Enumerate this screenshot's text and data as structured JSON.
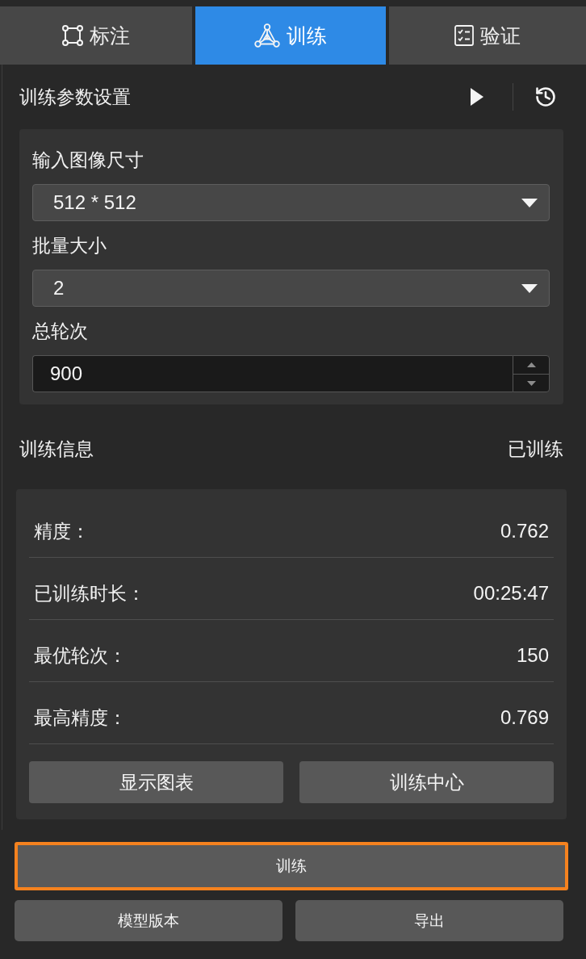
{
  "tabs": [
    {
      "label": "标注",
      "selected": false
    },
    {
      "label": "训练",
      "selected": true
    },
    {
      "label": "验证",
      "selected": false
    }
  ],
  "params": {
    "title": "训练参数设置",
    "fields": [
      {
        "kind": "select",
        "label": "输入图像尺寸",
        "value": "512 * 512"
      },
      {
        "kind": "select",
        "label": "批量大小",
        "value": "2"
      },
      {
        "kind": "number",
        "label": "总轮次",
        "value": "900"
      }
    ]
  },
  "info": {
    "title": "训练信息",
    "status": "已训练",
    "rows": [
      {
        "label": "精度：",
        "value": "0.762"
      },
      {
        "label": "已训练时长：",
        "value": "00:25:47"
      },
      {
        "label": "最优轮次：",
        "value": "150"
      },
      {
        "label": "最高精度：",
        "value": "0.769"
      }
    ],
    "buttons": [
      {
        "label": "显示图表"
      },
      {
        "label": "训练中心"
      }
    ]
  },
  "train_button": {
    "label": "训练",
    "focused": true
  },
  "footer_buttons": [
    {
      "label": "模型版本"
    },
    {
      "label": "导出"
    }
  ]
}
